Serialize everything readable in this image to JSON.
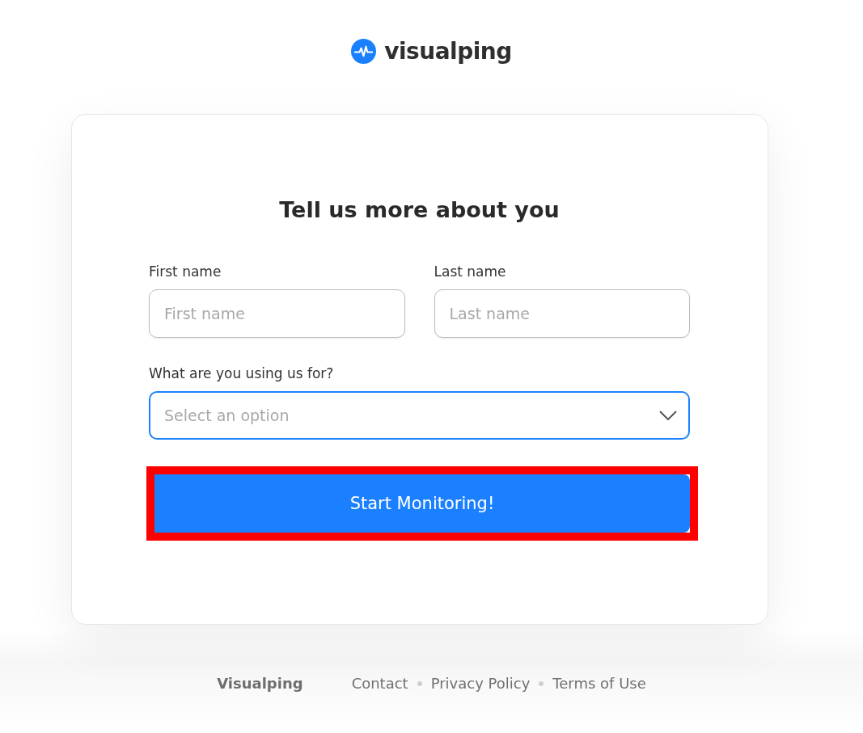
{
  "logo": {
    "text": "visualping"
  },
  "form": {
    "title": "Tell us more about you",
    "fields": [
      {
        "label": "First name",
        "placeholder": "First name"
      },
      {
        "label": "Last name",
        "placeholder": "Last name"
      }
    ],
    "select": {
      "label": "What are you using us for?",
      "placeholder": "Select an option",
      "focused": true
    },
    "button": {
      "label": "Start Monitoring!",
      "highlighted": true
    }
  },
  "footer": {
    "brand": "Visualping",
    "links": [
      "Contact",
      "Privacy Policy",
      "Terms of Use"
    ]
  }
}
